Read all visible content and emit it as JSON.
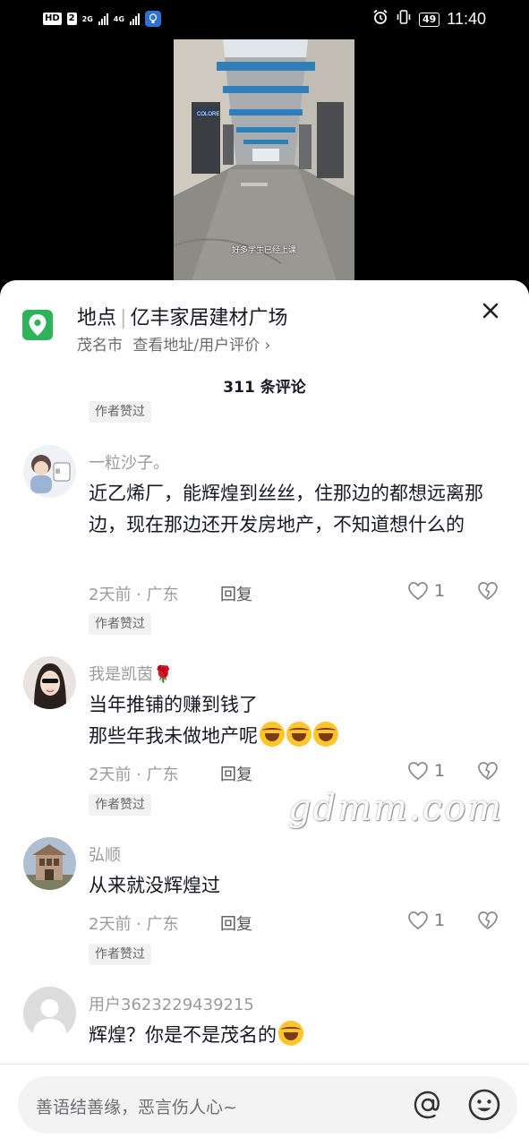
{
  "status_bar": {
    "hd": "HD",
    "sim": "2",
    "net1": "2G",
    "net2": "4G",
    "battery": "49",
    "time": "11:40"
  },
  "video": {
    "subtitle": "好多学生已经上课",
    "storefront_sign": "COLORE"
  },
  "location": {
    "label": "地点",
    "name": "亿丰家居建材广场",
    "city": "茂名市",
    "link": "查看地址/用户评价 ›"
  },
  "comments_count": "311 条评论",
  "author_liked_badge": "作者赞过",
  "comments": [
    {
      "user": "一粒沙子。",
      "text": "近乙烯厂，能辉煌到丝丝，住那边的都想远离那边，现在那边还开发房地产，不知道想什么的",
      "time": "2天前",
      "region": "广东",
      "reply": "回复",
      "likes": "1",
      "author_liked": "作者赞过"
    },
    {
      "user": "我是凯茵🌹",
      "text_line1": "当年推铺的赚到钱了",
      "text_line2": "那些年我未做地产呢",
      "time": "2天前",
      "region": "广东",
      "reply": "回复",
      "likes": "1",
      "author_liked": "作者赞过"
    },
    {
      "user": "弘顺",
      "text": "从来就没辉煌过",
      "time": "2天前",
      "region": "广东",
      "reply": "回复",
      "likes": "1",
      "author_liked": "作者赞过"
    },
    {
      "user": "用户3623229439215",
      "text": "辉煌？你是不是茂名的"
    }
  ],
  "input": {
    "placeholder": "善语结善缘，恶言伤人心~"
  },
  "watermark": "gdmm.com",
  "colors": {
    "location_green": "#2db45a",
    "text_primary": "#161823",
    "text_secondary": "#9b9b9b"
  }
}
